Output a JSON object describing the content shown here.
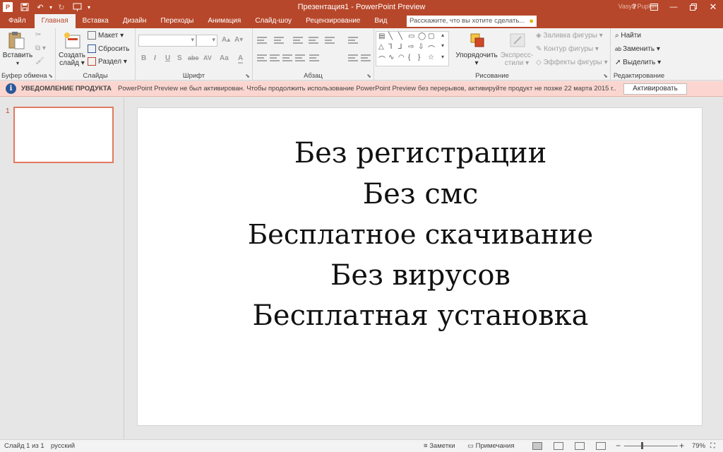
{
  "window": {
    "title": "Презентация1 - PowerPoint Preview",
    "user": "Vasya Pupkin",
    "logo_letter": "P",
    "icons": [
      "save-icon",
      "undo-icon",
      "redo-icon",
      "start-from-beginning-icon",
      "help-icon",
      "ribbon-display-icon",
      "minimize-icon",
      "maximize-icon",
      "close-icon"
    ]
  },
  "tabs": [
    {
      "label": "Файл"
    },
    {
      "label": "Главная"
    },
    {
      "label": "Вставка"
    },
    {
      "label": "Дизайн"
    },
    {
      "label": "Переходы"
    },
    {
      "label": "Анимация"
    },
    {
      "label": "Слайд-шоу"
    },
    {
      "label": "Рецензирование"
    },
    {
      "label": "Вид"
    }
  ],
  "active_tab": "Главная",
  "tell_me": {
    "placeholder": "Расскажите, что вы хотите сделать..."
  },
  "ribbon": {
    "clipboard": {
      "label": "Буфер обмена",
      "paste": "Вставить"
    },
    "slides": {
      "label": "Слайды",
      "new_slide_line1": "Создать",
      "new_slide_line2": "слайд",
      "layout": "Макет",
      "reset": "Сбросить",
      "section": "Раздел"
    },
    "font": {
      "label": "Шрифт",
      "buttons": [
        "B",
        "I",
        "U",
        "S",
        "abc",
        "AV",
        "Aa",
        "A"
      ]
    },
    "paragraph": {
      "label": "Абзац"
    },
    "drawing": {
      "label": "Рисование",
      "arrange": "Упорядочить",
      "quick_styles_line1": "Экспресс-",
      "quick_styles_line2": "стили",
      "shape_fill": "Заливка фигуры",
      "shape_outline": "Контур фигуры",
      "shape_effects": "Эффекты фигуры"
    },
    "editing": {
      "label": "Редактирование",
      "find": "Найти",
      "replace": "Заменить",
      "select": "Выделить"
    }
  },
  "notification": {
    "title": "УВЕДОМЛЕНИЕ ПРОДУКТА",
    "message": "PowerPoint Preview не был активирован. Чтобы продолжить использование PowerPoint Preview без перерывов, активируйте продукт не позже 22 марта 2015 г..",
    "button": "Активировать"
  },
  "thumbnails": [
    {
      "number": "1"
    }
  ],
  "slide": {
    "lines": [
      "Без регистрации",
      "Без смс",
      "Бесплатное скачивание",
      "Без вирусов",
      "Бесплатная установка"
    ]
  },
  "status": {
    "slide_info": "Слайд 1 из 1",
    "language": "русский",
    "notes": "Заметки",
    "comments": "Примечания",
    "zoom": "79%",
    "zoom_level_percent": 79
  },
  "colors": {
    "accent": "#b7472a",
    "notification_bg": "#fbd6d0"
  }
}
